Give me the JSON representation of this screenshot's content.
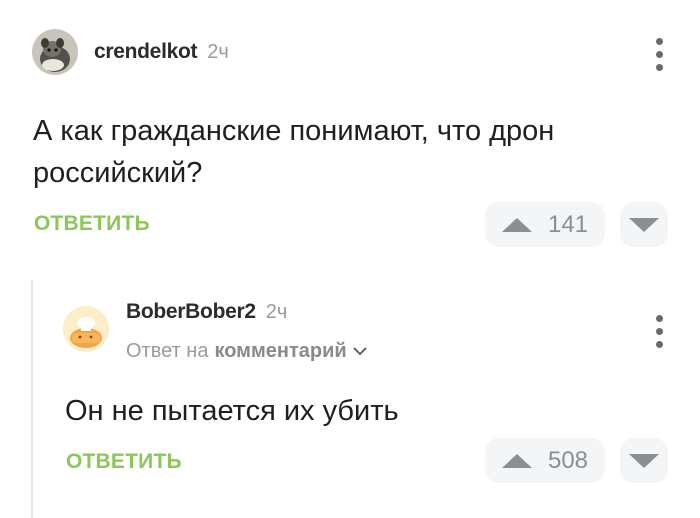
{
  "comment": {
    "username": "crendelkot",
    "time": "2ч",
    "text": "А как гражданские понимают, что дрон российский?",
    "reply_label": "ОТВЕТИТЬ",
    "votes": "141"
  },
  "reply": {
    "username": "BoberBober2",
    "time": "2ч",
    "reply_to_prefix": "Ответ на",
    "reply_to_link": "комментарий",
    "text": "Он не пытается их убить",
    "reply_label": "ОТВЕТИТЬ",
    "votes": "508"
  },
  "colors": {
    "accent_green": "#8ac858",
    "vote_bg": "#f3f5f7",
    "icon_gray": "#8a8f94"
  },
  "icons": [
    "more-vertical-icon",
    "upvote-triangle-icon",
    "downvote-triangle-icon",
    "chevron-down-icon"
  ]
}
